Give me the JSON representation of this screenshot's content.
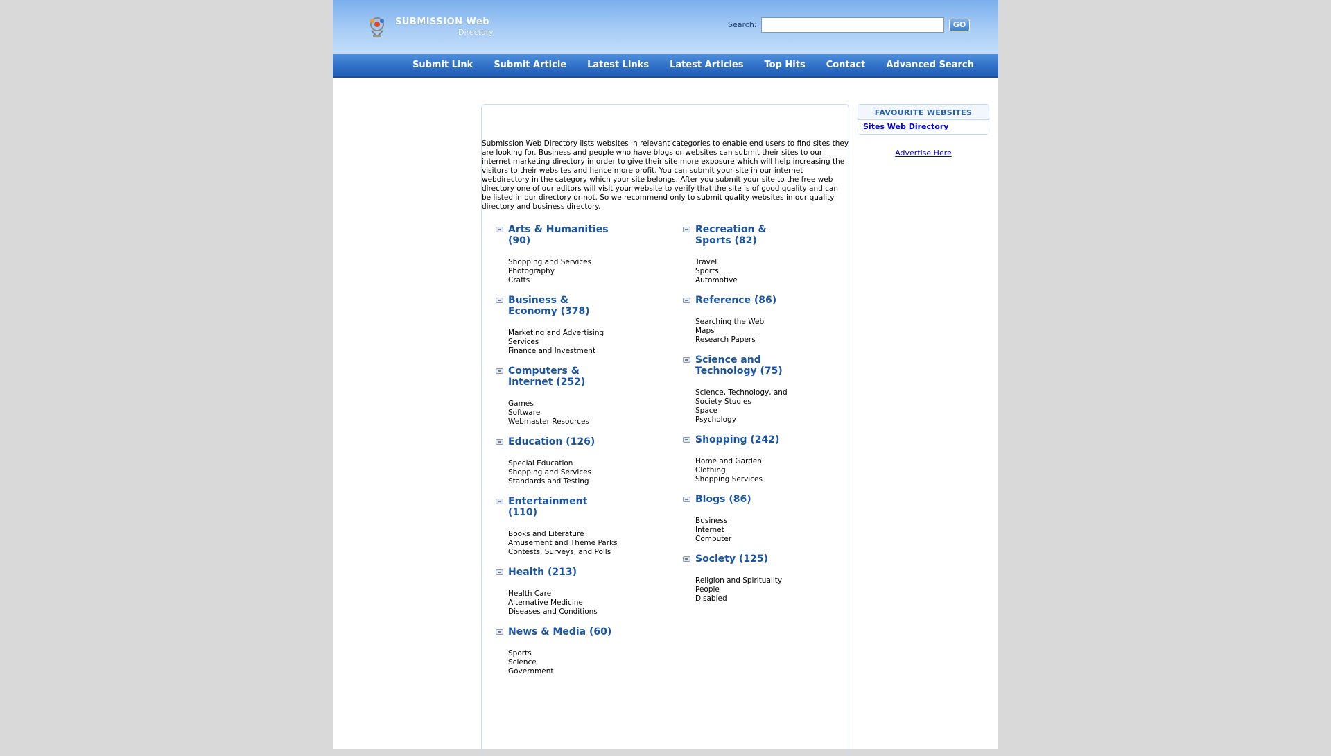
{
  "header": {
    "logo_line1": "SUBMISSION Web",
    "logo_line2": "Directory",
    "search_label": "Search:",
    "search_value": "",
    "search_button": "GO"
  },
  "nav": {
    "items": [
      "Submit Link",
      "Submit Article",
      "Latest Links",
      "Latest Articles",
      "Top Hits",
      "Contact",
      "Advanced Search"
    ]
  },
  "main": {
    "intro": "Submission Web Directory lists websites in relevant categories to enable end users to find sites they are looking for. Business and people who have blogs or websites can submit their sites to our internet marketing directory in order to give their site more exposure which will help increasing the visitors to their websites and hence more profit. You can submit your site in our internet webdirectory in the category which your site belongs. After you submit your site to the free web directory one of our editors will visit your website to verify that the site is of good quality and can be listed in our directory or not. So we recommend only to submit quality websites in our quality directory and business directory.",
    "left_categories": [
      {
        "title": "Arts & Humanities (90)",
        "subs": [
          "Shopping and Services",
          "Photography",
          "Crafts"
        ]
      },
      {
        "title": "Business & Economy (378)",
        "subs": [
          "Marketing and Advertising Services",
          "Finance and Investment"
        ]
      },
      {
        "title": "Computers & Internet (252)",
        "subs": [
          "Games",
          "Software",
          "Webmaster Resources"
        ]
      },
      {
        "title": "Education (126)",
        "subs": [
          "Special Education",
          "Shopping and Services",
          "Standards and Testing"
        ]
      },
      {
        "title": "Entertainment (110)",
        "subs": [
          "Books and Literature",
          "Amusement and Theme Parks",
          "Contests, Surveys, and Polls"
        ]
      },
      {
        "title": "Health (213)",
        "subs": [
          "Health Care",
          "Alternative Medicine",
          "Diseases and Conditions"
        ]
      },
      {
        "title": "News & Media (60)",
        "subs": [
          "Sports",
          "Science",
          "Government"
        ]
      }
    ],
    "right_categories": [
      {
        "title": "Recreation & Sports (82)",
        "subs": [
          "Travel",
          "Sports",
          "Automotive"
        ]
      },
      {
        "title": "Reference (86)",
        "subs": [
          "Searching the Web",
          "Maps",
          "Research Papers"
        ]
      },
      {
        "title": "Science and Technology (75)",
        "subs": [
          "Science, Technology, and Society Studies",
          "Space",
          "Psychology"
        ]
      },
      {
        "title": "Shopping (242)",
        "subs": [
          "Home and Garden",
          "Clothing",
          "Shopping Services"
        ]
      },
      {
        "title": "Blogs (86)",
        "subs": [
          "Business",
          "Internet",
          "Computer"
        ]
      },
      {
        "title": "Society (125)",
        "subs": [
          "Religion and Spirituality",
          "People",
          "Disabled"
        ]
      }
    ]
  },
  "sidebar": {
    "fav_title": "FAVOURITE WEBSITES",
    "fav_link": "Sites Web Directory",
    "advertise": "Advertise Here"
  },
  "colors": {
    "background": "#d9d9d9",
    "header_gradient_top": "#7aafec",
    "nav_blue": "#2f6fc7",
    "category_title": "#1a55a5",
    "link": "#0000cc"
  }
}
